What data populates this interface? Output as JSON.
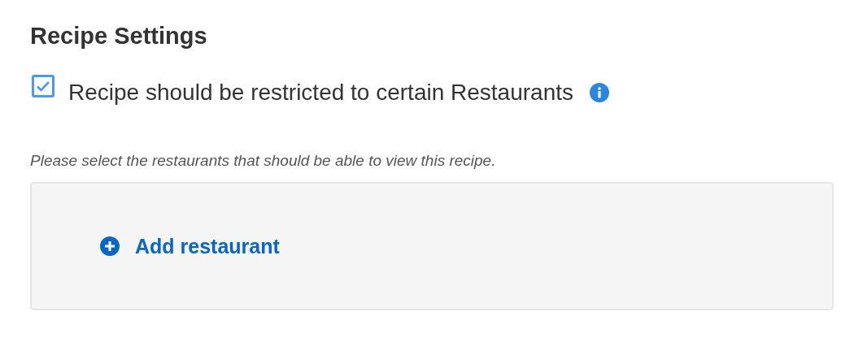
{
  "title": "Recipe Settings",
  "restrict": {
    "label": "Recipe should be restricted to certain Restaurants",
    "checked": true
  },
  "hint": "Please select the restaurants that should be able to view this recipe.",
  "add_button": {
    "label": "Add restaurant"
  }
}
